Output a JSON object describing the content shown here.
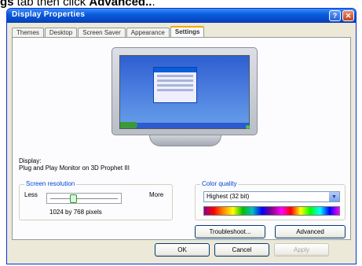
{
  "caption": {
    "prefix": "gs",
    "middle": " tab then click ",
    "bold": "Advanced..",
    "suffix": "."
  },
  "window": {
    "title": "Display Properties"
  },
  "tabs": [
    {
      "label": "Themes"
    },
    {
      "label": "Desktop"
    },
    {
      "label": "Screen Saver"
    },
    {
      "label": "Appearance"
    },
    {
      "label": "Settings"
    }
  ],
  "display": {
    "label": "Display:",
    "value": "Plug and Play Monitor on 3D Prophet III"
  },
  "resolution": {
    "title": "Screen resolution",
    "less": "Less",
    "more": "More",
    "value_text": "1024 by 768 pixels",
    "slider_fraction": 0.35
  },
  "color_quality": {
    "title": "Color quality",
    "selected": "Highest (32 bit)"
  },
  "buttons": {
    "troubleshoot": "Troubleshoot...",
    "advanced": "Advanced",
    "ok": "OK",
    "cancel": "Cancel",
    "apply": "Apply"
  },
  "colors": {
    "title_bar": "#0a5ddd",
    "window_bg": "#ece9d8",
    "active_tab_accent": "#f7a600"
  }
}
